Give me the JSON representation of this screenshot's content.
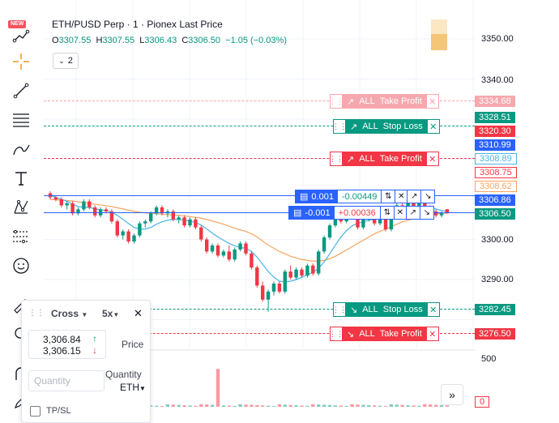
{
  "toolbar": {
    "new_badge": "NEW",
    "tools": [
      "trend-with-new-icon",
      "crosshair-icon",
      "trendline-icon",
      "fib-lines-icon",
      "brush-icon",
      "text-icon",
      "pattern-icon",
      "measure-icon",
      "emoji-icon",
      "ruler-icon",
      "zoom-icon",
      "magnet-icon",
      "pencil-icon"
    ]
  },
  "legend": {
    "title": "ETH/PUSD Perp · 1 · Pionex Last Price",
    "open_label": "O",
    "open": "3307.55",
    "high_label": "H",
    "high": "3307.55",
    "low_label": "L",
    "low": "3306.43",
    "close_label": "C",
    "close": "3306.50",
    "change": "−1.05 (−0.03%)",
    "collapse_count": "2"
  },
  "price_axis": {
    "ticks": [
      "3350.00",
      "3340.00",
      "3300.00",
      "3290.00"
    ],
    "volume_ticks": [
      "500",
      "0"
    ],
    "tags": {
      "tp_upper": "3334.68",
      "sl_upper": "3328.51",
      "red_1": "3320.30",
      "blue_1": "3310.99",
      "outline_blue": "3308.89",
      "outline_red": "3308.75",
      "outline_orange": "3308.62",
      "pos_long": "3306.86",
      "last_price": "3306.50",
      "sl_lower": "3282.45",
      "tp_lower": "3276.50"
    }
  },
  "orders": {
    "tp_upper": {
      "scope": "ALL",
      "type": "Take Profit"
    },
    "sl_upper": {
      "scope": "ALL",
      "type": "Stop Loss"
    },
    "tp_mid": {
      "scope": "ALL",
      "type": "Take Profit"
    },
    "sl_lower": {
      "scope": "ALL",
      "type": "Stop Loss"
    },
    "tp_lower": {
      "scope": "ALL",
      "type": "Take Profit"
    }
  },
  "positions": {
    "long": {
      "qty": "0.001",
      "pnl": "-0.00449"
    },
    "short": {
      "qty": "-0.001",
      "pnl": "+0.00036"
    }
  },
  "order_panel": {
    "margin_mode": "Cross",
    "leverage": "5x",
    "ask_price": "3,306.84",
    "bid_price": "3,306.15",
    "price_label": "Price",
    "quantity_placeholder": "Quantity",
    "quantity_label": "Quantity",
    "quantity_unit": "ETH",
    "tpsl_label": "TP/SL"
  },
  "colors": {
    "up": "#089981",
    "down": "#f23645",
    "tp": "#f23645",
    "sl": "#089981",
    "blue": "#2962ff",
    "ma_blue": "#4bb4e6",
    "ma_orange": "#f4a460"
  },
  "chart_data": {
    "type": "candlestick",
    "symbol": "ETH/PUSD Perp",
    "interval": "1",
    "y_range": [
      3270,
      3355
    ],
    "y_ticks": [
      3350,
      3340,
      3300,
      3290
    ],
    "candles": [
      [
        3311.5,
        3312.0,
        3310.0,
        3310.5
      ],
      [
        3310.5,
        3311.0,
        3309.5,
        3310.0
      ],
      [
        3310.0,
        3310.5,
        3308.0,
        3308.5
      ],
      [
        3308.5,
        3309.5,
        3307.5,
        3309.0
      ],
      [
        3309.0,
        3309.5,
        3306.0,
        3306.5
      ],
      [
        3306.5,
        3308.0,
        3306.0,
        3307.5
      ],
      [
        3307.5,
        3310.0,
        3307.0,
        3309.5
      ],
      [
        3309.5,
        3310.0,
        3307.5,
        3308.0
      ],
      [
        3308.0,
        3308.5,
        3305.5,
        3306.0
      ],
      [
        3306.0,
        3308.0,
        3305.5,
        3307.5
      ],
      [
        3307.5,
        3308.0,
        3306.5,
        3307.0
      ],
      [
        3307.0,
        3307.5,
        3304.0,
        3304.5
      ],
      [
        3304.5,
        3305.0,
        3300.5,
        3301.0
      ],
      [
        3301.0,
        3302.5,
        3300.0,
        3302.0
      ],
      [
        3302.0,
        3302.5,
        3299.0,
        3299.5
      ],
      [
        3299.5,
        3301.5,
        3299.0,
        3301.0
      ],
      [
        3301.0,
        3304.5,
        3300.5,
        3304.0
      ],
      [
        3304.0,
        3305.0,
        3303.0,
        3304.5
      ],
      [
        3304.5,
        3307.0,
        3304.0,
        3306.5
      ],
      [
        3306.5,
        3308.5,
        3306.0,
        3308.0
      ],
      [
        3308.0,
        3308.5,
        3306.0,
        3306.5
      ],
      [
        3306.5,
        3307.5,
        3305.5,
        3307.0
      ],
      [
        3307.0,
        3307.5,
        3304.5,
        3305.0
      ],
      [
        3305.0,
        3306.0,
        3304.0,
        3305.5
      ],
      [
        3305.5,
        3306.0,
        3303.0,
        3303.5
      ],
      [
        3303.5,
        3305.5,
        3303.0,
        3305.0
      ],
      [
        3305.0,
        3305.5,
        3302.5,
        3303.0
      ],
      [
        3303.0,
        3303.5,
        3299.5,
        3300.0
      ],
      [
        3300.0,
        3300.5,
        3296.5,
        3297.0
      ],
      [
        3297.0,
        3299.0,
        3296.5,
        3298.5
      ],
      [
        3298.5,
        3299.0,
        3295.5,
        3296.0
      ],
      [
        3296.0,
        3297.5,
        3295.5,
        3297.0
      ],
      [
        3297.0,
        3298.5,
        3294.5,
        3295.0
      ],
      [
        3295.0,
        3298.0,
        3294.5,
        3297.5
      ],
      [
        3297.5,
        3299.5,
        3297.0,
        3299.0
      ],
      [
        3299.0,
        3299.5,
        3296.0,
        3296.5
      ],
      [
        3296.5,
        3297.0,
        3292.5,
        3293.0
      ],
      [
        3293.0,
        3293.5,
        3288.0,
        3288.5
      ],
      [
        3288.5,
        3289.5,
        3284.5,
        3285.0
      ],
      [
        3285.0,
        3287.5,
        3282.0,
        3287.0
      ],
      [
        3287.0,
        3289.5,
        3286.0,
        3289.0
      ],
      [
        3289.0,
        3289.5,
        3286.5,
        3287.0
      ],
      [
        3287.0,
        3292.5,
        3286.5,
        3292.0
      ],
      [
        3292.0,
        3293.5,
        3290.0,
        3290.5
      ],
      [
        3290.5,
        3293.0,
        3290.0,
        3292.5
      ],
      [
        3292.5,
        3293.0,
        3290.5,
        3291.0
      ],
      [
        3291.0,
        3294.0,
        3290.5,
        3293.5
      ],
      [
        3293.5,
        3294.0,
        3291.0,
        3291.5
      ],
      [
        3291.5,
        3297.5,
        3291.0,
        3297.0
      ],
      [
        3297.0,
        3301.0,
        3296.5,
        3300.5
      ],
      [
        3300.5,
        3304.0,
        3300.0,
        3303.5
      ],
      [
        3303.5,
        3306.5,
        3303.0,
        3306.0
      ],
      [
        3306.0,
        3307.0,
        3304.0,
        3304.5
      ],
      [
        3304.5,
        3307.5,
        3304.0,
        3307.0
      ],
      [
        3307.0,
        3307.5,
        3305.5,
        3306.0
      ],
      [
        3306.0,
        3306.5,
        3302.5,
        3303.0
      ],
      [
        3303.0,
        3305.5,
        3302.5,
        3305.0
      ],
      [
        3305.0,
        3306.5,
        3304.5,
        3306.0
      ],
      [
        3306.0,
        3306.5,
        3303.5,
        3304.0
      ],
      [
        3304.0,
        3306.0,
        3303.5,
        3305.5
      ],
      [
        3305.5,
        3306.0,
        3302.0,
        3302.5
      ],
      [
        3302.5,
        3306.5,
        3302.0,
        3306.0
      ],
      [
        3306.0,
        3309.0,
        3305.5,
        3308.5
      ],
      [
        3308.5,
        3309.0,
        3306.5,
        3307.0
      ],
      [
        3307.0,
        3309.5,
        3306.5,
        3309.0
      ],
      [
        3309.0,
        3309.5,
        3307.0,
        3307.5
      ],
      [
        3307.5,
        3309.5,
        3307.0,
        3309.0
      ],
      [
        3309.0,
        3311.5,
        3307.5,
        3308.0
      ],
      [
        3308.0,
        3308.5,
        3306.5,
        3307.0
      ],
      [
        3307.0,
        3307.5,
        3305.5,
        3306.0
      ],
      [
        3306.0,
        3307.0,
        3305.5,
        3306.5
      ],
      [
        3307.55,
        3307.55,
        3306.43,
        3306.5
      ]
    ],
    "ma_fast": [
      3311.0,
      3310.5,
      3310.0,
      3309.5,
      3308.8,
      3308.2,
      3308.0,
      3308.0,
      3307.6,
      3307.4,
      3307.2,
      3306.8,
      3306.0,
      3305.0,
      3304.0,
      3303.0,
      3302.6,
      3302.6,
      3303.0,
      3303.8,
      3304.4,
      3304.8,
      3305.0,
      3305.0,
      3304.8,
      3304.6,
      3304.2,
      3303.6,
      3302.6,
      3301.6,
      3300.6,
      3299.8,
      3299.0,
      3298.4,
      3298.0,
      3297.8,
      3297.0,
      3295.6,
      3293.8,
      3292.0,
      3290.6,
      3289.6,
      3289.4,
      3289.6,
      3290.0,
      3290.6,
      3291.2,
      3291.8,
      3292.8,
      3294.4,
      3296.4,
      3298.6,
      3300.6,
      3302.2,
      3303.4,
      3304.0,
      3304.4,
      3304.8,
      3305.0,
      3305.2,
      3305.2,
      3305.4,
      3305.8,
      3306.2,
      3306.6,
      3307.0,
      3307.4,
      3307.8,
      3307.8,
      3307.6,
      3307.2,
      3307.0
    ],
    "ma_slow": [
      3310.0,
      3309.9,
      3309.8,
      3309.7,
      3309.6,
      3309.4,
      3309.2,
      3309.0,
      3308.8,
      3308.6,
      3308.4,
      3308.2,
      3307.9,
      3307.6,
      3307.3,
      3307.0,
      3306.8,
      3306.6,
      3306.5,
      3306.4,
      3306.3,
      3306.2,
      3306.1,
      3306.0,
      3305.9,
      3305.7,
      3305.5,
      3305.3,
      3305.0,
      3304.6,
      3304.2,
      3303.8,
      3303.3,
      3302.8,
      3302.4,
      3302.0,
      3301.4,
      3300.6,
      3299.6,
      3298.6,
      3297.8,
      3297.0,
      3296.4,
      3295.8,
      3295.4,
      3295.0,
      3294.8,
      3294.6,
      3294.6,
      3294.8,
      3295.2,
      3295.8,
      3296.6,
      3297.4,
      3298.2,
      3299.0,
      3299.8,
      3300.6,
      3301.4,
      3302.0,
      3302.6,
      3303.2,
      3303.8,
      3304.4,
      3304.8,
      3305.2,
      3305.6,
      3306.0,
      3306.2,
      3306.4,
      3306.5,
      3306.6
    ],
    "volume": {
      "ylim": [
        0,
        500
      ],
      "spike_index": 30,
      "spike_value": 390,
      "tail": [
        30,
        10,
        60,
        20,
        25,
        15,
        70,
        10
      ]
    }
  }
}
